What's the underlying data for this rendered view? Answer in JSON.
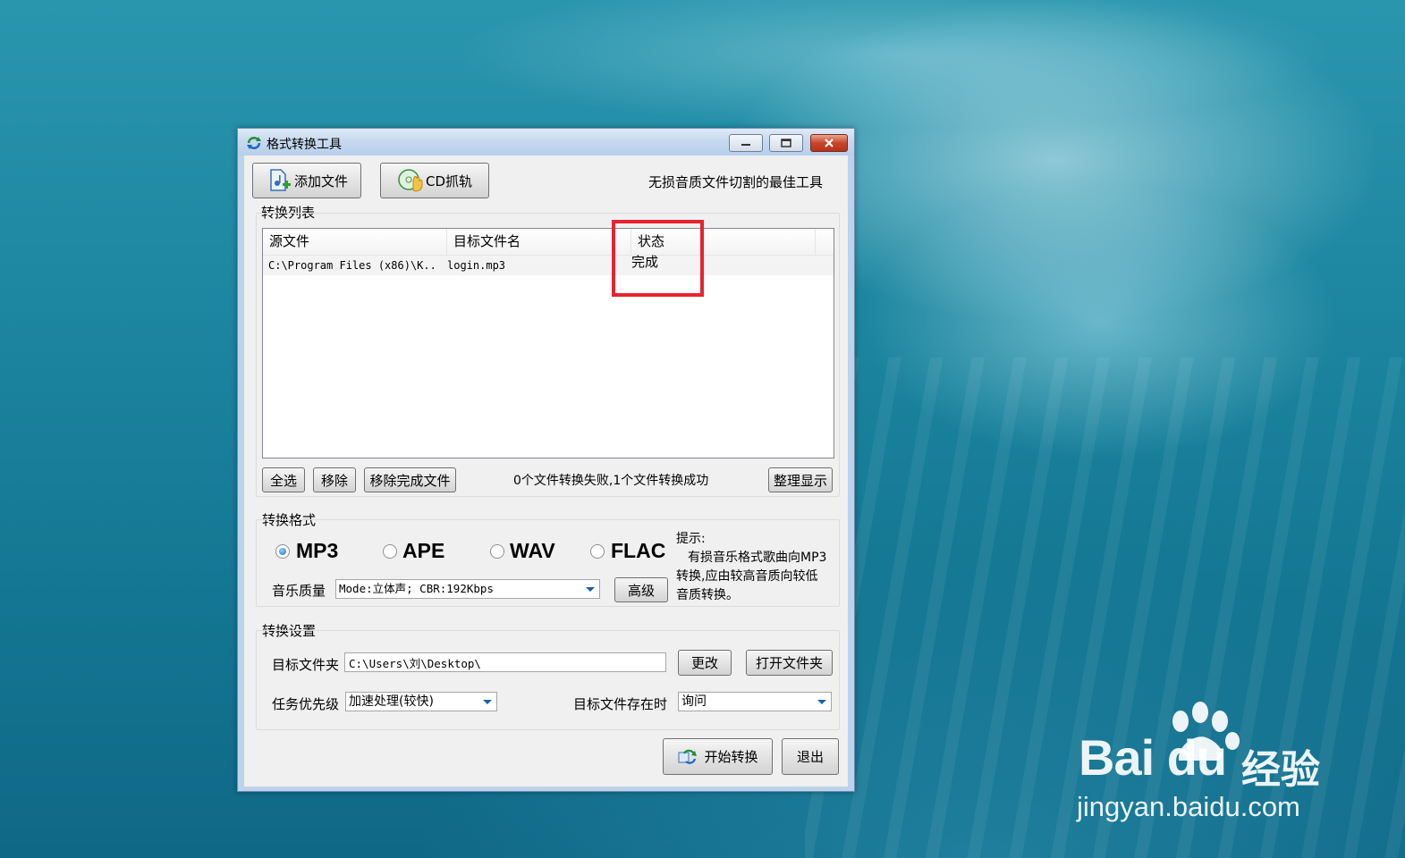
{
  "window": {
    "title": "格式转换工具"
  },
  "toolbar": {
    "add_file_label": "添加文件",
    "cd_rip_label": "CD抓轨",
    "slogan": "无损音质文件切割的最佳工具"
  },
  "list_section": {
    "title": "转换列表",
    "columns": [
      "源文件",
      "目标文件名",
      "状态"
    ],
    "rows": [
      {
        "source": "C:\\Program Files (x86)\\K..",
        "target": "login.mp3",
        "status": "完成"
      }
    ],
    "select_all_label": "全选",
    "remove_label": "移除",
    "remove_done_label": "移除完成文件",
    "summary": "0个文件转换失败,1个文件转换成功",
    "arrange_label": "整理显示"
  },
  "format_section": {
    "title": "转换格式",
    "formats": [
      "MP3",
      "APE",
      "WAV",
      "FLAC"
    ],
    "selected": "MP3",
    "quality_label": "音乐质量",
    "quality_value": "Mode:立体声; CBR:192Kbps",
    "advanced_label": "高级",
    "hint_title": "提示:",
    "hint_line1": "有损音乐格式歌曲向MP3",
    "hint_line2": "转换,应由较高音质向较低",
    "hint_line3": "音质转换。"
  },
  "settings_section": {
    "title": "转换设置",
    "target_folder_label": "目标文件夹",
    "target_folder_value": "C:\\Users\\刘\\Desktop\\",
    "change_label": "更改",
    "open_folder_label": "打开文件夹",
    "priority_label": "任务优先级",
    "priority_value": "加速处理(较快)",
    "exists_label": "目标文件存在时",
    "exists_value": "询问"
  },
  "actions": {
    "start_label": "开始转换",
    "exit_label": "退出"
  },
  "watermark": {
    "brand": "Bai du",
    "cn": "经验",
    "url": "jingyan.baidu.com"
  },
  "colors": {
    "highlight_box": "#e8232d",
    "accent_blue": "#1a5fa8"
  }
}
